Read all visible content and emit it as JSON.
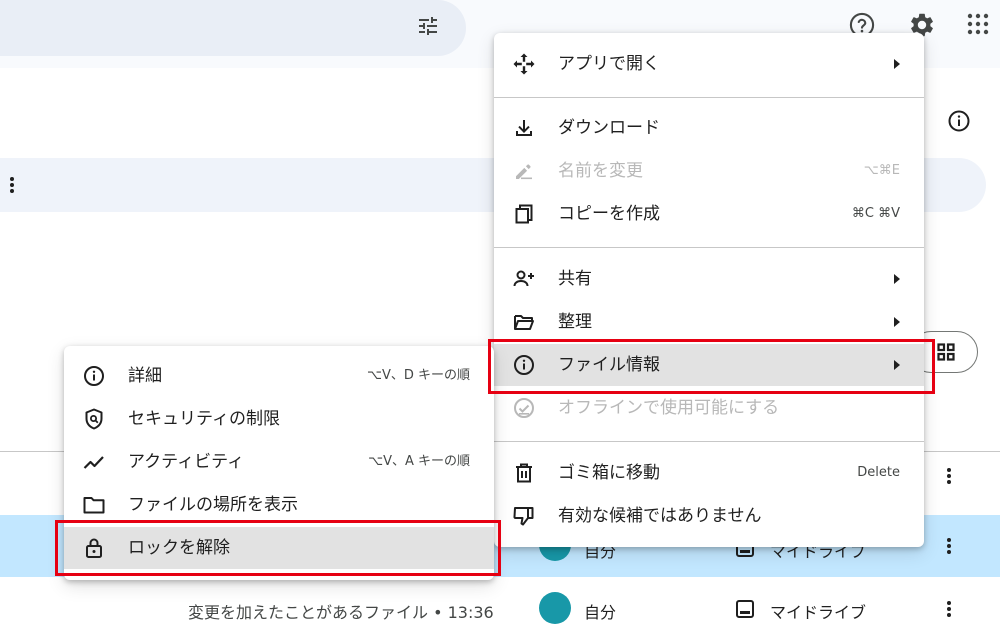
{
  "colors": {
    "accent_highlight": "#e2e2e2",
    "selected_row": "#c2e7ff",
    "callout_red": "#e60012",
    "avatar": "#1898a8"
  },
  "main_menu": {
    "items": [
      {
        "label": "アプリで開く",
        "icon": "move-arrows-icon",
        "submenu": true
      },
      {
        "label": "ダウンロード",
        "icon": "download-icon"
      },
      {
        "label": "名前を変更",
        "icon": "pencil-icon",
        "shortcut": "⌥⌘E",
        "disabled": true
      },
      {
        "label": "コピーを作成",
        "icon": "copy-icon",
        "shortcut": "⌘C ⌘V"
      },
      {
        "label": "共有",
        "icon": "person-add-icon",
        "submenu": true
      },
      {
        "label": "整理",
        "icon": "folder-open-icon",
        "submenu": true
      },
      {
        "label": "ファイル情報",
        "icon": "info-icon",
        "submenu": true,
        "highlighted": true
      },
      {
        "label": "オフラインで使用可能にする",
        "icon": "offline-check-icon",
        "disabled": true
      },
      {
        "label": "ゴミ箱に移動",
        "icon": "trash-icon",
        "shortcut": "Delete"
      },
      {
        "label": "有効な候補ではありません",
        "icon": "thumbs-down-icon"
      }
    ]
  },
  "sub_menu": {
    "items": [
      {
        "label": "詳細",
        "icon": "info-icon",
        "shortcut": "⌥V、D キーの順"
      },
      {
        "label": "セキュリティの制限",
        "icon": "shield-search-icon"
      },
      {
        "label": "アクティビティ",
        "icon": "trending-icon",
        "shortcut": "⌥V、A キーの順"
      },
      {
        "label": "ファイルの場所を表示",
        "icon": "folder-icon"
      },
      {
        "label": "ロックを解除",
        "icon": "lock-icon",
        "highlighted": true
      }
    ]
  },
  "file_rows": [
    {
      "meta": "変更を加えたことがあるファイル • 13:36",
      "owner": "自分",
      "location": "マイドライブ"
    }
  ],
  "row2": {
    "owner": "自分",
    "location": "マイドライブ"
  }
}
